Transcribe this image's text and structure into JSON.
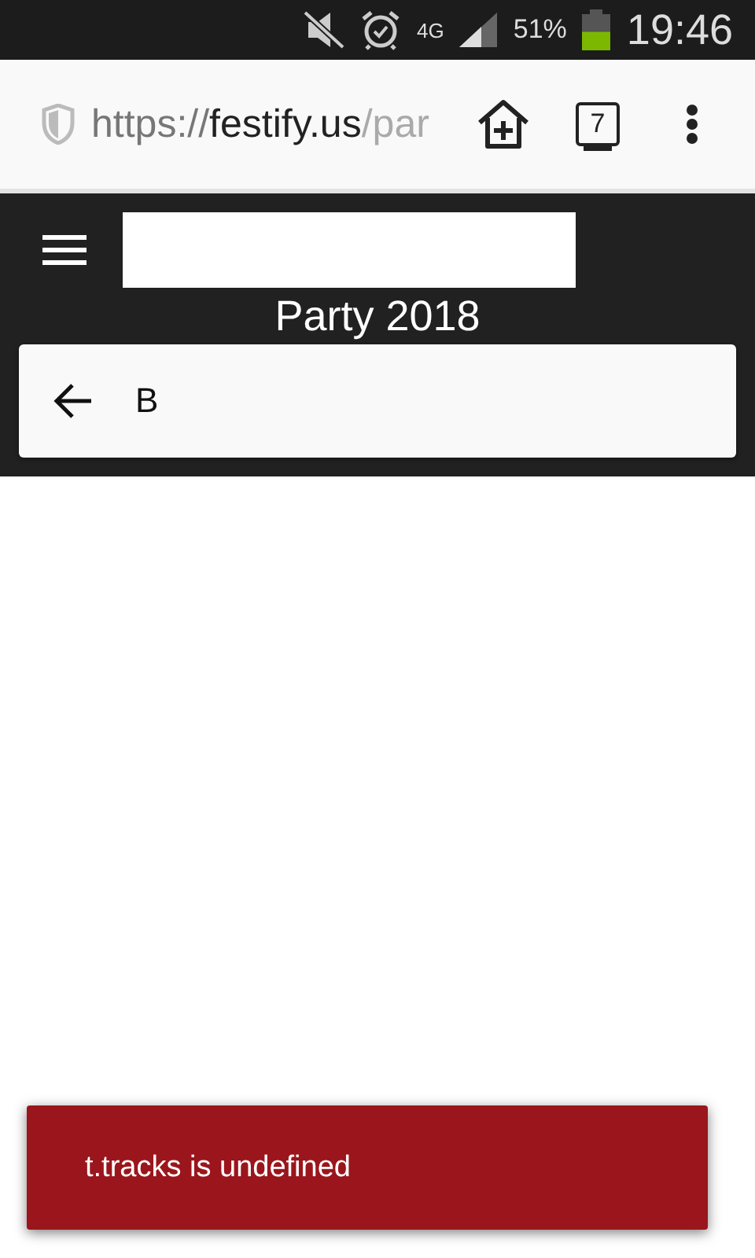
{
  "status_bar": {
    "network": "4G",
    "battery_text": "51%",
    "battery": {
      "level": 0.51
    },
    "time": "19:46"
  },
  "browser": {
    "url": {
      "scheme": "https://",
      "host": "festify.us",
      "path": "/par"
    },
    "tab_count": "7"
  },
  "header": {
    "title": "Party 2018"
  },
  "search": {
    "value": "B"
  },
  "snackbar": {
    "message": "t.tracks is undefined"
  }
}
